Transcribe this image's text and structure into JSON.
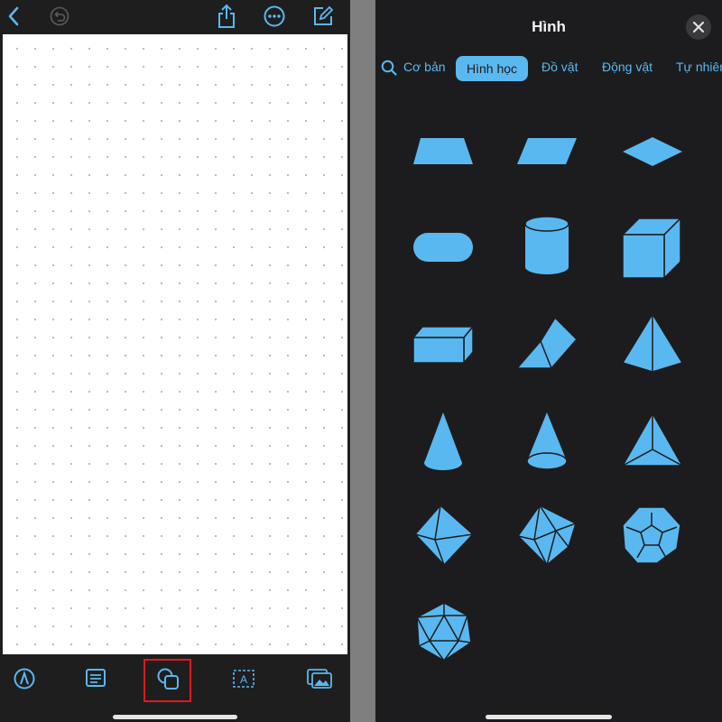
{
  "panel": {
    "title": "Hình",
    "close_icon": "close-icon"
  },
  "tabs": [
    {
      "label": "Cơ bản",
      "active": false
    },
    {
      "label": "Hình học",
      "active": true
    },
    {
      "label": "Đồ vật",
      "active": false
    },
    {
      "label": "Động vật",
      "active": false
    },
    {
      "label": "Tự nhiên",
      "active": false
    }
  ],
  "shapes": [
    "trapezoid-shape",
    "parallelogram-shape",
    "rhombus-shape",
    "stadium-shape",
    "cylinder-shape",
    "cube-shape",
    "rectangular-prism-shape",
    "triangular-prism-shape",
    "square-pyramid-shape",
    "cone-shape",
    "narrow-cone-shape",
    "triangular-pyramid-shape",
    "octahedron-shape",
    "decahedron-shape",
    "dodecahedron-shape",
    "icosahedron-shape"
  ],
  "toolbar": {
    "top_icons": [
      "back-chevron-icon",
      "undo-icon",
      "share-icon",
      "more-icon",
      "compose-icon"
    ],
    "bottom_icons": [
      "pen-icon",
      "text-box-icon",
      "shapes-icon",
      "text-tool-icon",
      "media-icon"
    ]
  },
  "colors": {
    "accent": "#5ab8f0",
    "highlight_box": "#e0191e",
    "panel_bg": "#1c1c1e"
  }
}
